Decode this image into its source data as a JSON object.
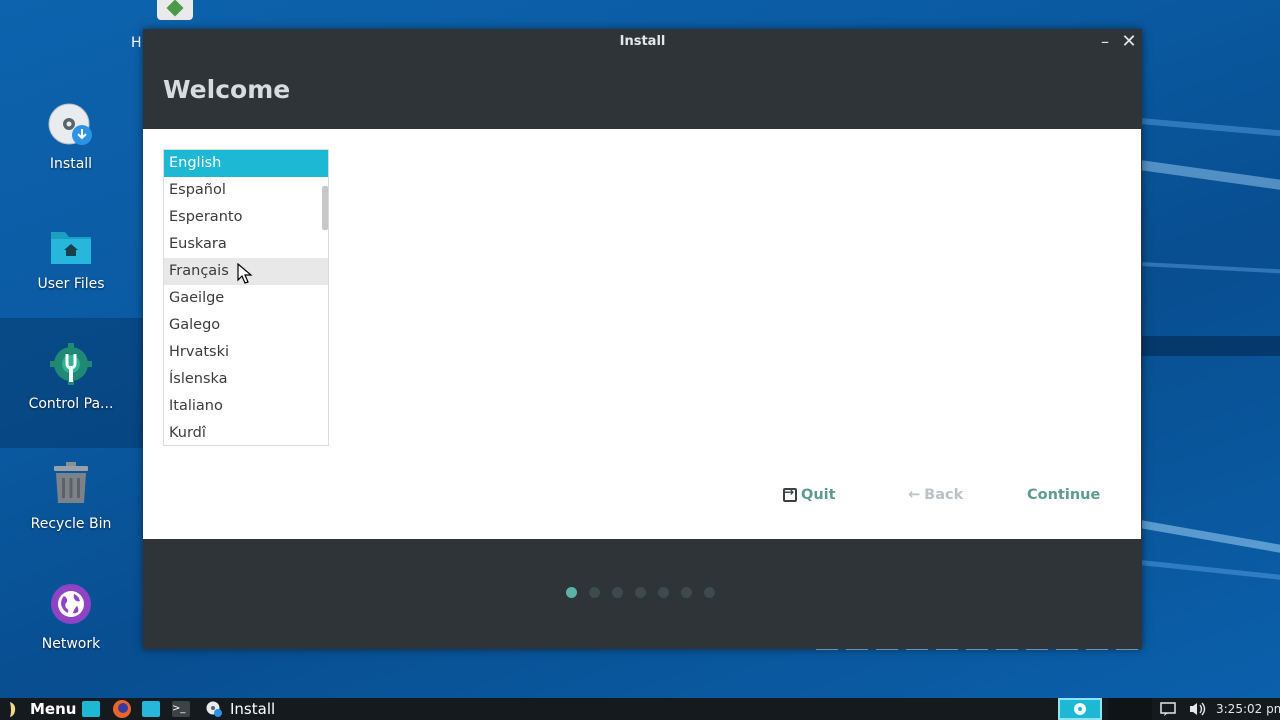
{
  "desktop": {
    "partial_label": "H",
    "icons": [
      {
        "label": "Install",
        "icon": "install-disc-icon"
      },
      {
        "label": "User Files",
        "icon": "home-folder-icon"
      },
      {
        "label": "Control Pa...",
        "icon": "control-panel-gear-icon"
      },
      {
        "label": "Recycle Bin",
        "icon": "trash-bin-icon"
      },
      {
        "label": "Network",
        "icon": "globe-icon"
      }
    ]
  },
  "window": {
    "title": "Install",
    "heading": "Welcome",
    "languages": [
      "English",
      "Español",
      "Esperanto",
      "Euskara",
      "Français",
      "Gaeilge",
      "Galego",
      "Hrvatski",
      "Íslenska",
      "Italiano",
      "Kurdî"
    ],
    "selected_language": "English",
    "hovered_language": "Français",
    "buttons": {
      "quit": "Quit",
      "back": "Back",
      "continue": "Continue"
    },
    "steps": {
      "total": 7,
      "current": 1
    }
  },
  "taskbar": {
    "menu_label": "Menu",
    "task_label": "Install",
    "clock": "3:25:02 pm"
  },
  "colors": {
    "accent": "#1cb8d4",
    "button_text": "#5d9b92",
    "disabled_text": "#b9c3c5",
    "window_bg": "#2e3438"
  }
}
